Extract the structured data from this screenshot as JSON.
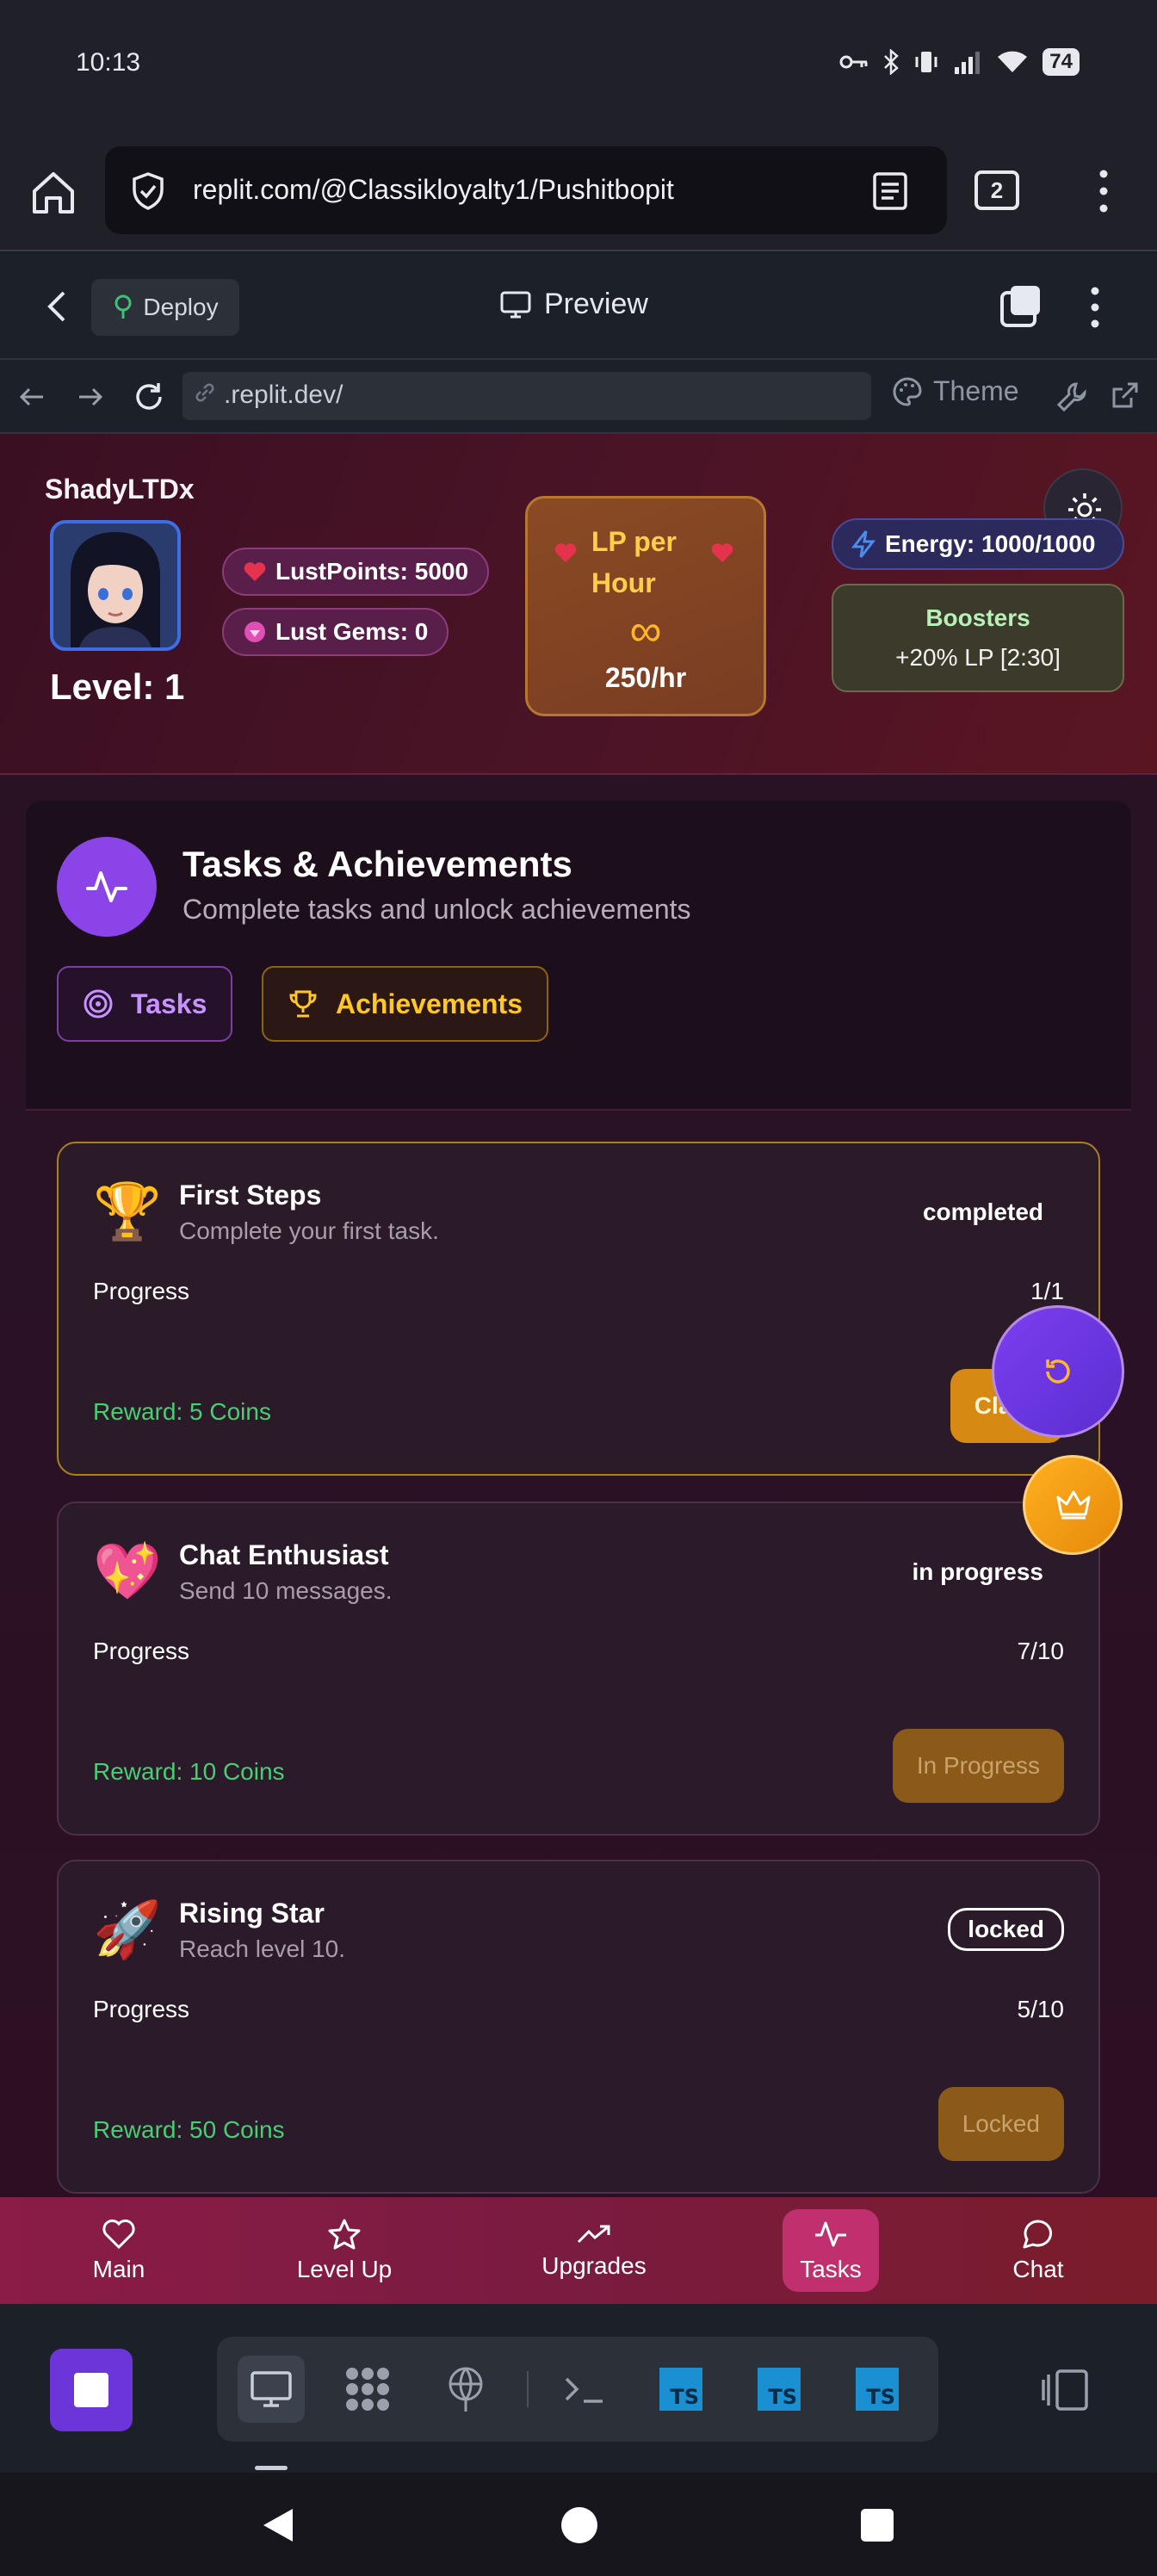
{
  "statusbar": {
    "time": "10:13",
    "battery": "74"
  },
  "browser": {
    "url": "replit.com/@Classikloyalty1/Pushitbopit",
    "tab_count": "2"
  },
  "replit": {
    "deploy_label": "Deploy",
    "preview_label": "Preview",
    "address": ".replit.dev/",
    "theme_label": "Theme"
  },
  "profile": {
    "username": "ShadyLTDx",
    "level": "Level: 1",
    "lust_points": "LustPoints: 5000",
    "lust_gems": "Lust Gems: 0",
    "lp_per_hour_title": "LP per Hour",
    "lp_infinity": "∞",
    "lp_rate": "250/hr",
    "energy": "Energy: 1000/1000",
    "boosters_title": "Boosters",
    "boosters_detail": "+20% LP [2:30]"
  },
  "panel": {
    "title": "Tasks & Achievements",
    "subtitle": "Complete tasks and unlock achievements",
    "tabs": [
      {
        "label": "Tasks"
      },
      {
        "label": "Achievements"
      }
    ]
  },
  "cards": [
    {
      "emoji": "🏆",
      "title": "First Steps",
      "desc": "Complete your first task.",
      "status": "completed",
      "progress_label": "Progress",
      "progress": "1/1",
      "reward": "Reward: 5 Coins",
      "button": "Claim"
    },
    {
      "emoji": "💖",
      "title": "Chat Enthusiast",
      "desc": "Send 10 messages.",
      "status": "in progress",
      "progress_label": "Progress",
      "progress": "7/10",
      "reward": "Reward: 10 Coins",
      "button": "In Progress"
    },
    {
      "emoji": "🚀",
      "title": "Rising Star",
      "desc": "Reach level 10.",
      "status": "locked",
      "progress_label": "Progress",
      "progress": "5/10",
      "reward": "Reward: 50 Coins",
      "button": "Locked"
    }
  ],
  "nav": [
    {
      "label": "Main",
      "icon": "heart-icon"
    },
    {
      "label": "Level Up",
      "icon": "star-icon"
    },
    {
      "label": "Upgrades",
      "icon": "trending-up-icon"
    },
    {
      "label": "Tasks",
      "icon": "activity-icon"
    },
    {
      "label": "Chat",
      "icon": "chat-bubble-icon"
    }
  ],
  "dock": {
    "ts_label": "TS"
  },
  "colors": {
    "accent_purple": "#8b44e8",
    "gold": "#ffc62a",
    "reward_green": "#46d072",
    "nav_active": "#c02f6e"
  }
}
